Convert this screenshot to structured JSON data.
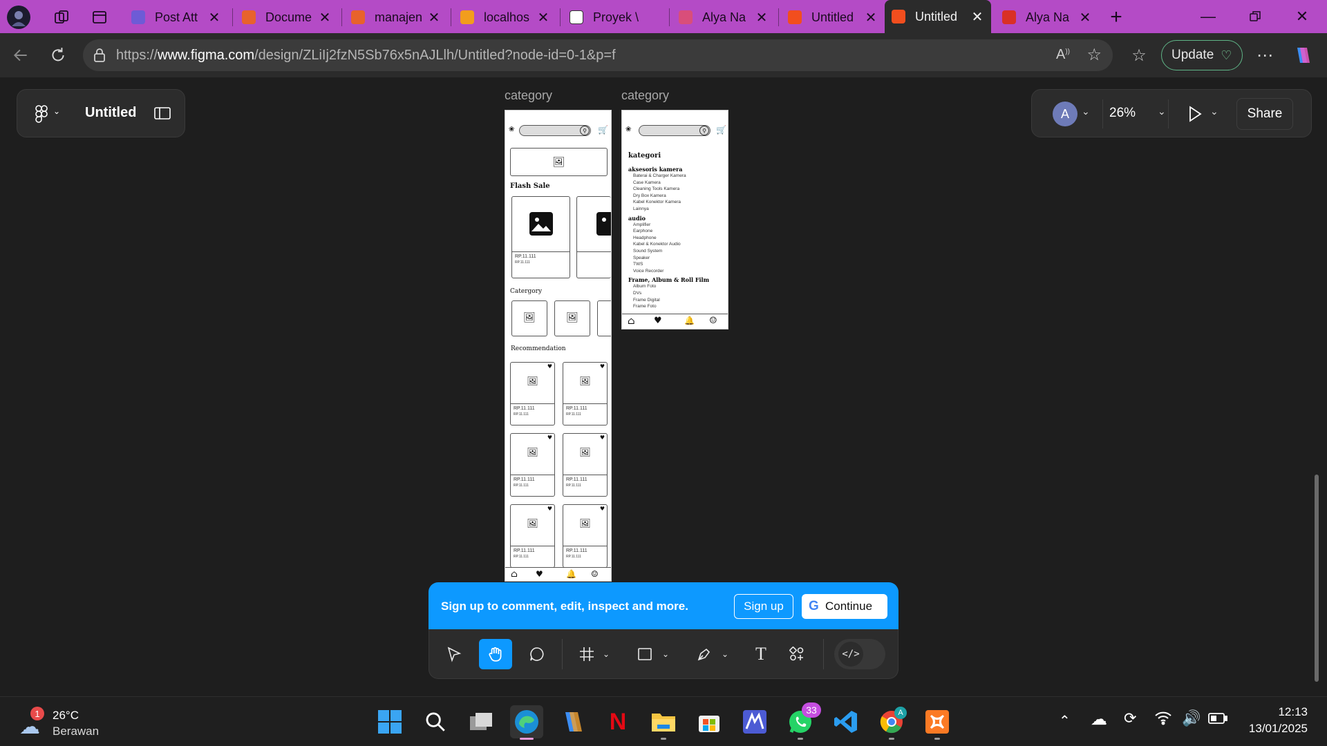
{
  "browser": {
    "tabs": [
      {
        "title": "Post Att",
        "favicon_color": "#6e5bd6"
      },
      {
        "title": "Docume",
        "favicon_color": "#e8622c"
      },
      {
        "title": "manajen",
        "favicon_color": "#e8622c"
      },
      {
        "title": "localhos",
        "favicon_color": "#f29d1d"
      },
      {
        "title": "Proyek \\",
        "favicon_color": "#ffffff"
      },
      {
        "title": "Alya Na",
        "favicon_color": "#d94e7a"
      },
      {
        "title": "Untitled",
        "favicon_color": "#f24e1e"
      },
      {
        "title": "Untitled",
        "favicon_color": "#f24e1e",
        "active": true
      },
      {
        "title": "Alya Na",
        "favicon_color": "#d93025"
      }
    ],
    "url": {
      "prefix": "https://",
      "host": "www.figma.com",
      "path": "/design/ZLiIj2fzN5Sb76x5nAJLlh/Untitled?node-id=0-1&p=f"
    },
    "update_label": "Update"
  },
  "figma": {
    "file_name": "Untitled",
    "avatar_initial": "A",
    "zoom": "26%",
    "share_label": "Share",
    "frames": [
      {
        "label": "category",
        "flash_sale": "Flash Sale",
        "price": "RP.11.111",
        "price_small": "RP.11.111",
        "category_title": "Catergory",
        "recommendation_title": "Recommendation"
      },
      {
        "label": "category",
        "heading": "kategori",
        "groups": [
          {
            "name": "aksesoris kamera",
            "items": [
              "Baterai & Charger Kamera",
              "Case Kamera",
              "Cleaning Tools Kamera",
              "Dry Box Kamera",
              "Kabel Konektor Kamera",
              "Lainnya"
            ]
          },
          {
            "name": "audio",
            "items": [
              "Amplifier",
              "Earphone",
              "Headphone",
              "Kabel & Konektor Audio",
              "Sound System",
              "Speaker",
              "TWS",
              "Voice Recorder"
            ]
          },
          {
            "name": "Frame, Album & Roll Film",
            "items": [
              "Album Foto",
              "DVs",
              "Frame Digital",
              "Frame Foto"
            ]
          }
        ]
      }
    ],
    "signup_banner": {
      "text": "Sign up to comment, edit, inspect and more.",
      "signup_label": "Sign up",
      "continue_label": "Continue"
    }
  },
  "taskbar": {
    "weather": {
      "temp": "26°C",
      "condition": "Berawan",
      "badge": "1"
    },
    "whatsapp_badge": "33",
    "time": "12:13",
    "date": "13/01/2025"
  }
}
